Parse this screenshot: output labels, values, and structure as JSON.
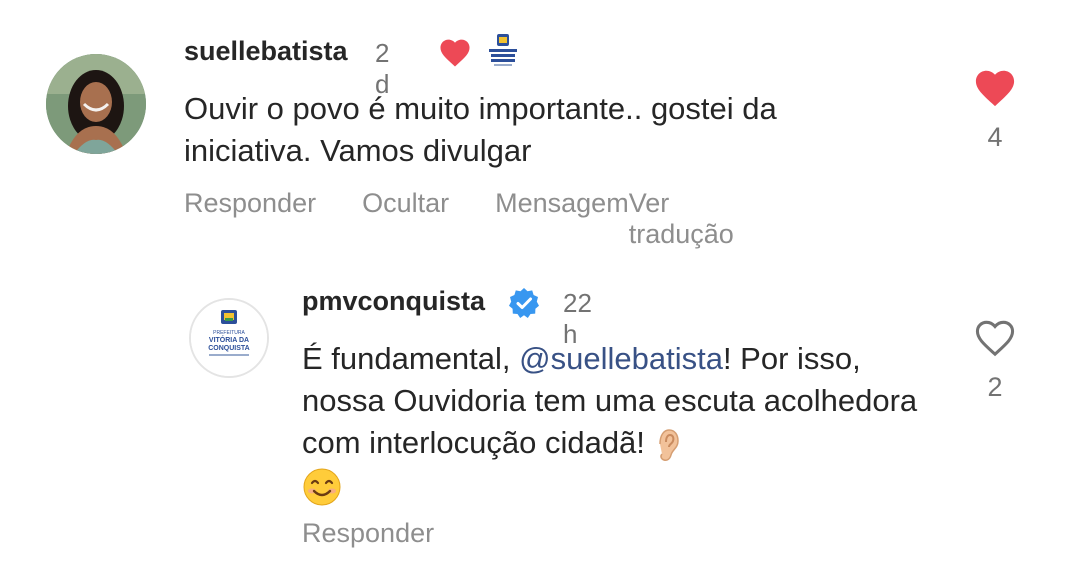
{
  "comment": {
    "username": "suellebatista",
    "time": "2 d",
    "text": "Ouvir o povo é muito importante.. gostei da iniciativa. Vamos divulgar",
    "actions": {
      "reply": "Responder",
      "hide": "Ocultar",
      "message": "Mensagem",
      "translate": "Ver tradução"
    },
    "like_count": "4",
    "liked": true,
    "creator_liked": true
  },
  "reply": {
    "username": "pmvconquista",
    "verified": true,
    "time": "22 h",
    "text_before": "É fundamental, ",
    "mention": "@suellebatista",
    "text_after": "! Por isso, nossa Ouvidoria tem uma escuta acolhedora com interlocução cidadã!",
    "emoji_1": "ear",
    "emoji_2": "smiling-face",
    "actions": {
      "reply": "Responder"
    },
    "like_count": "2",
    "liked": false,
    "avatar_lines": {
      "top": "PREFEITURA",
      "middle_1": "VITÓRIA DA",
      "middle_2": "CONQUISTA"
    }
  },
  "colors": {
    "like_red": "#ed4956",
    "verified_blue": "#3897f0",
    "mention_blue": "#385185",
    "muted_text": "#8e8e8e"
  }
}
